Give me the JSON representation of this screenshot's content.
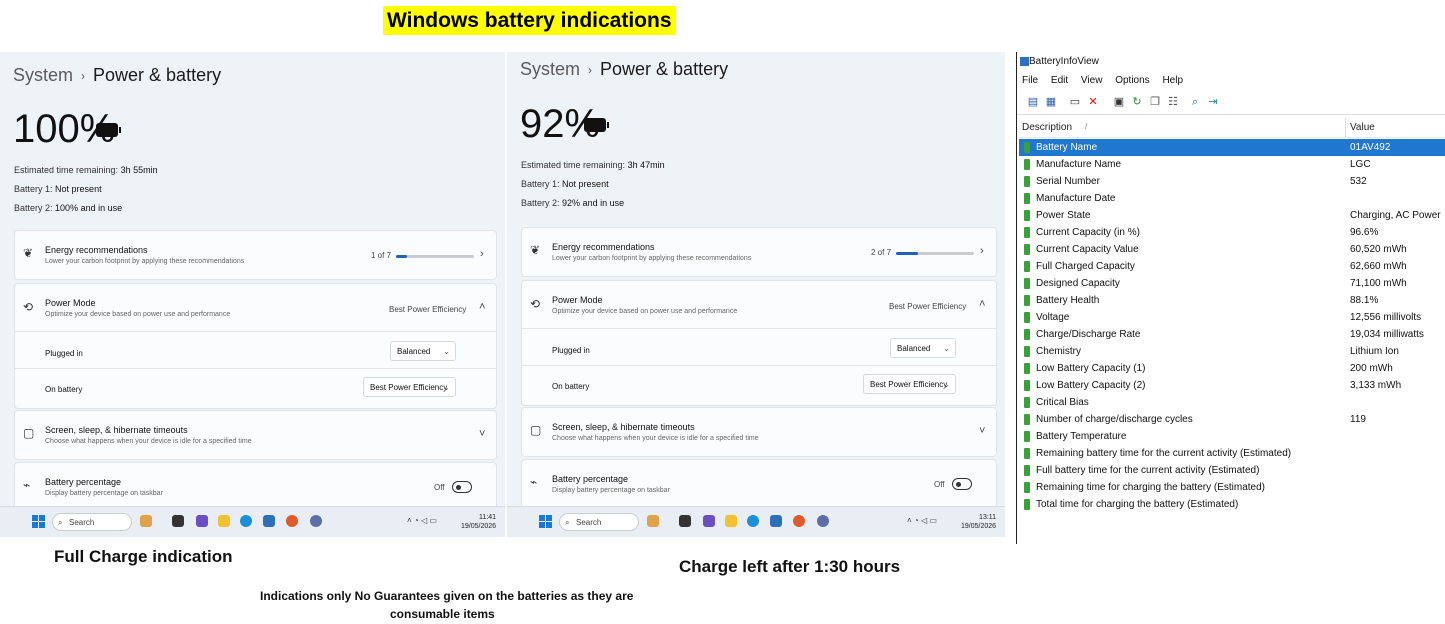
{
  "heading": "Windows battery indications",
  "panels": [
    {
      "crumb_parent": "System",
      "crumb_current": "Power & battery",
      "percent": "100%",
      "est_label": "Estimated time remaining:",
      "est_value": "3h 55min",
      "b1_label": "Battery 1:",
      "b1_value": "Not present",
      "b2_label": "Battery 2:",
      "b2_value": "100% and in use",
      "energy_title": "Energy recommendations",
      "energy_sub": "Lower your carbon footprint by applying these recommendations",
      "energy_count": "1 of 7",
      "energy_progress": 0.14,
      "power_mode_title": "Power Mode",
      "power_mode_sub": "Optimize your device based on power use and performance",
      "power_mode_value": "Best Power Efficiency",
      "plugged_label": "Plugged in",
      "plugged_value": "Balanced",
      "onbatt_label": "On battery",
      "onbatt_value": "Best Power Efficiency",
      "screen_title": "Screen, sleep, & hibernate timeouts",
      "screen_sub": "Choose what happens when your device is idle for a specified time",
      "pct_title": "Battery percentage",
      "pct_sub": "Display battery percentage on taskbar",
      "pct_state": "Off",
      "search": "Search",
      "time": "11:41",
      "date": "19/05/2026"
    },
    {
      "crumb_parent": "System",
      "crumb_current": "Power & battery",
      "percent": "92%",
      "est_label": "Estimated time remaining:",
      "est_value": "3h 47min",
      "b1_label": "Battery 1:",
      "b1_value": "Not present",
      "b2_label": "Battery 2:",
      "b2_value": "92% and in use",
      "energy_title": "Energy recommendations",
      "energy_sub": "Lower your carbon footprint by applying these recommendations",
      "energy_count": "2 of 7",
      "energy_progress": 0.28,
      "power_mode_title": "Power Mode",
      "power_mode_sub": "Optimize your device based on power use and performance",
      "power_mode_value": "Best Power Efficiency",
      "plugged_label": "Plugged in",
      "plugged_value": "Balanced",
      "onbatt_label": "On battery",
      "onbatt_value": "Best Power Efficiency",
      "screen_title": "Screen, sleep, & hibernate timeouts",
      "screen_sub": "Choose what happens when your device is idle for a specified time",
      "pct_title": "Battery percentage",
      "pct_sub": "Display battery percentage on taskbar",
      "pct_state": "Off",
      "search": "Search",
      "time": "13:11",
      "date": "19/05/2026"
    }
  ],
  "biv": {
    "title": "BatteryInfoView",
    "menu": [
      "File",
      "Edit",
      "View",
      "Options",
      "Help"
    ],
    "col_description": "Description",
    "col_value": "Value",
    "rows": [
      {
        "d": "Battery Name",
        "v": "01AV492"
      },
      {
        "d": "Manufacture Name",
        "v": "LGC"
      },
      {
        "d": "Serial Number",
        "v": "532"
      },
      {
        "d": "Manufacture Date",
        "v": ""
      },
      {
        "d": "Power State",
        "v": "Charging, AC Power"
      },
      {
        "d": "Current Capacity (in %)",
        "v": "96.6%"
      },
      {
        "d": "Current Capacity Value",
        "v": "60,520 mWh"
      },
      {
        "d": "Full Charged Capacity",
        "v": "62,660 mWh"
      },
      {
        "d": "Designed Capacity",
        "v": "71,100 mWh"
      },
      {
        "d": "Battery Health",
        "v": "88.1%"
      },
      {
        "d": "Voltage",
        "v": "12,556 millivolts"
      },
      {
        "d": "Charge/Discharge Rate",
        "v": "19,034 milliwatts"
      },
      {
        "d": "Chemistry",
        "v": "Lithium Ion"
      },
      {
        "d": "Low Battery Capacity (1)",
        "v": "200 mWh"
      },
      {
        "d": "Low Battery Capacity (2)",
        "v": "3,133 mWh"
      },
      {
        "d": "Critical Bias",
        "v": ""
      },
      {
        "d": "Number of charge/discharge cycles",
        "v": "119"
      },
      {
        "d": "Battery Temperature",
        "v": ""
      },
      {
        "d": "Remaining battery time for the current activity (Estimated)",
        "v": ""
      },
      {
        "d": "Full battery time for the current activity (Estimated)",
        "v": ""
      },
      {
        "d": "Remaining time for charging the battery (Estimated)",
        "v": ""
      },
      {
        "d": "Total  time for charging the battery (Estimated)",
        "v": ""
      }
    ]
  },
  "captions": {
    "full_charge": "Full Charge indication",
    "charge_left": "Charge left after 1:30 hours",
    "disclaimer_1": "Indications only No Guarantees given on the batteries as they are",
    "disclaimer_2": "consumable items"
  }
}
